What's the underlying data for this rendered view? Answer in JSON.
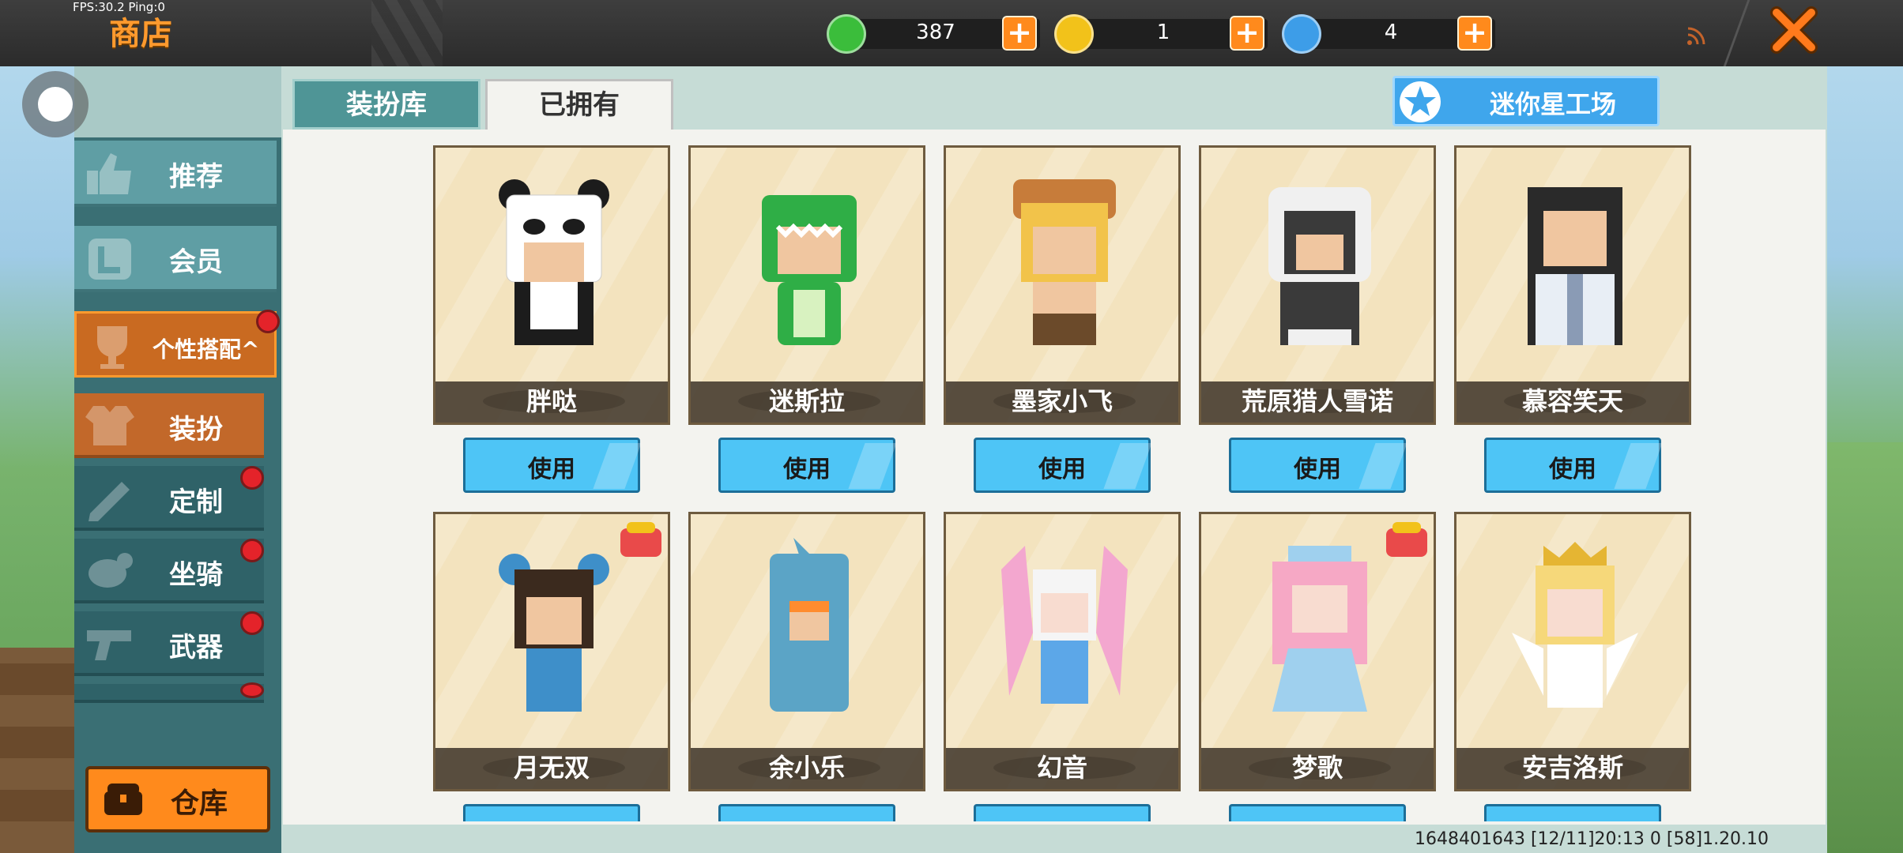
{
  "status": {
    "fps": "FPS:30.2  Ping:0"
  },
  "header": {
    "title": "商店",
    "currencies": [
      {
        "name": "gem-icon",
        "value": "387",
        "color": "#3bbd3b"
      },
      {
        "name": "gold-coin-icon",
        "value": "1",
        "color": "#f2c21a"
      },
      {
        "name": "blue-coin-icon",
        "value": "4",
        "color": "#3d9de8"
      }
    ],
    "plus_label": "+"
  },
  "sidebar": {
    "items": [
      {
        "label": "推荐",
        "icon": "thumbs-up-icon"
      },
      {
        "label": "会员",
        "icon": "member-icon"
      },
      {
        "label": "个性搭配",
        "icon": "trophy-icon",
        "expand": "^"
      }
    ],
    "sub_items": [
      {
        "label": "装扮",
        "icon": "outfit-icon"
      },
      {
        "label": "定制",
        "icon": "pencil-icon"
      },
      {
        "label": "坐骑",
        "icon": "mount-icon"
      },
      {
        "label": "武器",
        "icon": "gun-icon"
      }
    ],
    "warehouse_label": "仓库"
  },
  "tabs": [
    {
      "label": "装扮库"
    },
    {
      "label": "已拥有"
    }
  ],
  "studio_button": {
    "label": "迷你星工场"
  },
  "cards": [
    {
      "name": "胖哒",
      "palette": [
        "#ffffff",
        "#1c1c1c"
      ]
    },
    {
      "name": "迷斯拉",
      "palette": [
        "#2fae46",
        "#d8f2c0"
      ]
    },
    {
      "name": "墨家小飞",
      "palette": [
        "#c77c3a",
        "#f2c34a"
      ]
    },
    {
      "name": "荒原猎人雪诺",
      "palette": [
        "#3a3a3a",
        "#f0f0f0"
      ]
    },
    {
      "name": "慕容笑天",
      "palette": [
        "#2a2a2a",
        "#e8eef5"
      ]
    },
    {
      "name": "月无双",
      "palette": [
        "#3e8fc9",
        "#3b2a1e"
      ]
    },
    {
      "name": "余小乐",
      "palette": [
        "#5ba4c6",
        "#ff8c2e"
      ]
    },
    {
      "name": "幻音",
      "palette": [
        "#f3a7cf",
        "#5ca7e8"
      ]
    },
    {
      "name": "梦歌",
      "palette": [
        "#f6a8c5",
        "#9fd0ee"
      ]
    },
    {
      "name": "安吉洛斯",
      "palette": [
        "#f6d87a",
        "#ffffff"
      ]
    }
  ],
  "use_label": "使用",
  "footer": {
    "info": "1648401643   [12/11]20:13 0    [58]1.20.10"
  }
}
